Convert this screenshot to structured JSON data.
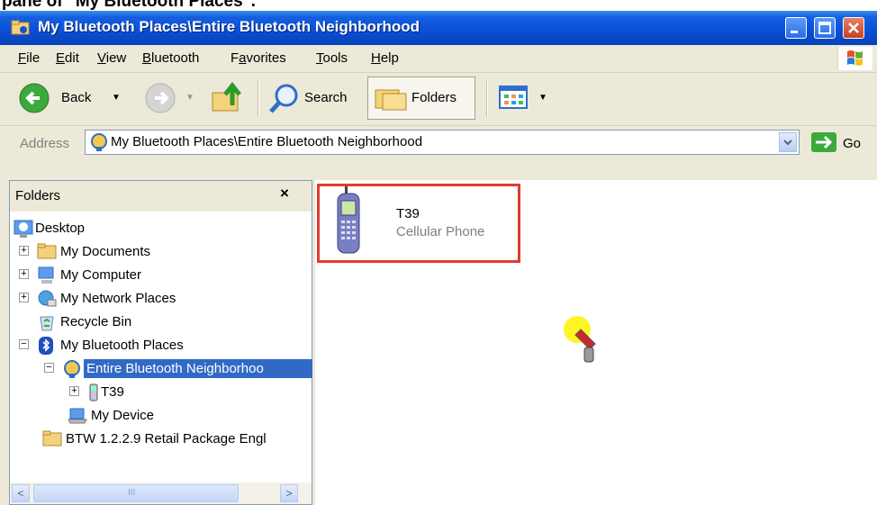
{
  "caption": {
    "text": "pane of \"My Bluetooth Places\"."
  },
  "window": {
    "title": "My Bluetooth Places\\Entire Bluetooth Neighborhood"
  },
  "menu": [
    {
      "label": "File",
      "mnemonic": "F",
      "rest": "ile"
    },
    {
      "label": "Edit",
      "mnemonic": "E",
      "rest": "dit"
    },
    {
      "label": "View",
      "mnemonic": "V",
      "rest": "iew"
    },
    {
      "label": "Bluetooth",
      "mnemonic": "B",
      "rest": "luetooth"
    },
    {
      "label": "Favorites",
      "pre": "F",
      "mnemonic": "a",
      "rest": "vorites"
    },
    {
      "label": "Tools",
      "mnemonic": "T",
      "rest": "ools"
    },
    {
      "label": "Help",
      "mnemonic": "H",
      "rest": "elp"
    }
  ],
  "toolbar": {
    "back_label": "Back",
    "search_label": "Search",
    "folders_label": "Folders"
  },
  "address": {
    "label": "Address",
    "value": "My Bluetooth Places\\Entire Bluetooth Neighborhood",
    "go_label": "Go"
  },
  "folders_pane": {
    "title": "Folders",
    "close_glyph": "×",
    "tree": [
      {
        "label": "Desktop",
        "icon": "desktop-icon"
      },
      {
        "label": "My Documents",
        "icon": "folder-icon",
        "expander": "+"
      },
      {
        "label": "My Computer",
        "icon": "computer-icon",
        "expander": "+"
      },
      {
        "label": "My Network Places",
        "icon": "network-icon",
        "expander": "+"
      },
      {
        "label": "Recycle Bin",
        "icon": "recycle-bin-icon"
      },
      {
        "label": "My Bluetooth Places",
        "icon": "bluetooth-icon",
        "expander": "−"
      },
      {
        "label": "Entire Bluetooth Neighborhoo",
        "icon": "bluetooth-neighborhood-icon",
        "expander": "−",
        "selected": true
      },
      {
        "label": "T39",
        "icon": "phone-icon",
        "expander": "+"
      },
      {
        "label": "My Device",
        "icon": "laptop-icon"
      },
      {
        "label": "BTW 1.2.2.9 Retail Package Engl",
        "icon": "folder-icon"
      }
    ],
    "scrollbar": {
      "left_glyph": "<",
      "right_glyph": ">",
      "grip": "III"
    }
  },
  "content": {
    "items": [
      {
        "name": "T39",
        "type": "Cellular Phone",
        "icon": "cellphone-icon"
      }
    ]
  },
  "colors": {
    "titlebar": "#0A50D8",
    "selection": "#316AC5",
    "highlight_border": "#E03C31",
    "chrome": "#ECE9D8"
  }
}
